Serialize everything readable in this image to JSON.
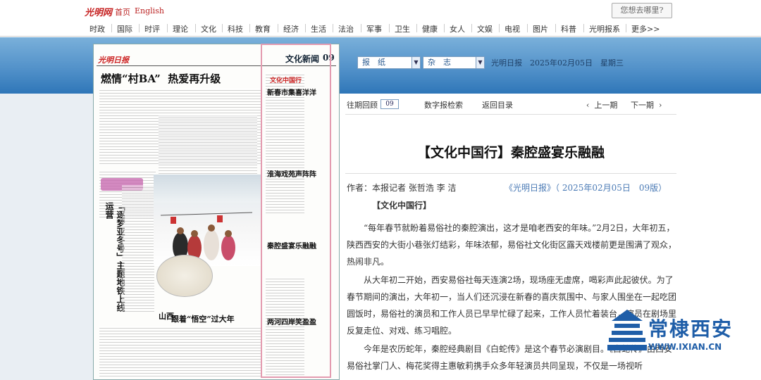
{
  "header": {
    "logo": "光明网",
    "home": "首页",
    "english": "English",
    "search_placeholder": "您想去哪里?"
  },
  "nav": [
    "时政",
    "国际",
    "时评",
    "理论",
    "文化",
    "科技",
    "教育",
    "经济",
    "生活",
    "法治",
    "军事",
    "卫生",
    "健康",
    "女人",
    "文娱",
    "电视",
    "图片",
    "科普",
    "光明报系",
    "更多>>"
  ],
  "paper_page": {
    "masthead": "光明日报",
    "section": "文化新闻",
    "page_no": "09",
    "headline_prefix": "燃情",
    "headline_quote": "“村BA”",
    "headline_suffix": "热爱再升级",
    "column_label": "文化中国行",
    "sub1": "新春市集喜洋洋",
    "sub2": "淮海戏苑声阵阵",
    "sub3": "秦腔盛宴乐融融",
    "sub4": "两河四岸笑盈盈",
    "vertical_headline": "「逐梦亚冬号」主题地铁上线运营",
    "bottom_headline": "跟着“悟空”过大年",
    "small_label": "山西"
  },
  "selector": {
    "paper_label": "报　纸",
    "magazine_label": "杂　志",
    "date_text": "光明日报　2025年02月05日　星期三"
  },
  "toolbar": {
    "past_issues": "往期回顾",
    "issue_no": "09",
    "search": "数字报检索",
    "back": "返回目录",
    "prev": "上一期",
    "next": "下一期"
  },
  "article": {
    "title": "【文化中国行】秦腔盛宴乐融融",
    "byline": "作者：本报记者 张哲浩 李 洁",
    "source": "《光明日报》（ 2025年02月05日　09版）",
    "column_tag": "【文化中国行】",
    "p1": "“每年春节就盼着易俗社的秦腔演出，这才是咱老西安的年味。”2月2日，大年初五，陕西西安的大街小巷张灯结彩，年味浓郁，易俗社文化街区露天戏楼前更是围满了观众，热闹非凡。",
    "p2": "从大年初二开始，西安易俗社每天连演2场，现场座无虚席，喝彩声此起彼伏。为了春节期间的演出，大年初一，当人们还沉浸在新春的喜庆氛围中、与家人围坐在一起吃团圆饭时，易俗社的演员和工作人员已早早忙碌了起来，工作人员忙着装台，演员在剧场里反复走位、对戏、练习唱腔。",
    "p3": "今年是农历蛇年，秦腔经典剧目《白蛇传》是这个春节必演剧目。《白蛇传》由西安易俗社掌门人、梅花奖得主惠敏莉携手众多年轻演员共同呈现，不仅是一场视听"
  },
  "watermark": {
    "text": "常棣西安",
    "url": "WWW.IXIAN.CN",
    "color": "#1f5ea8"
  }
}
